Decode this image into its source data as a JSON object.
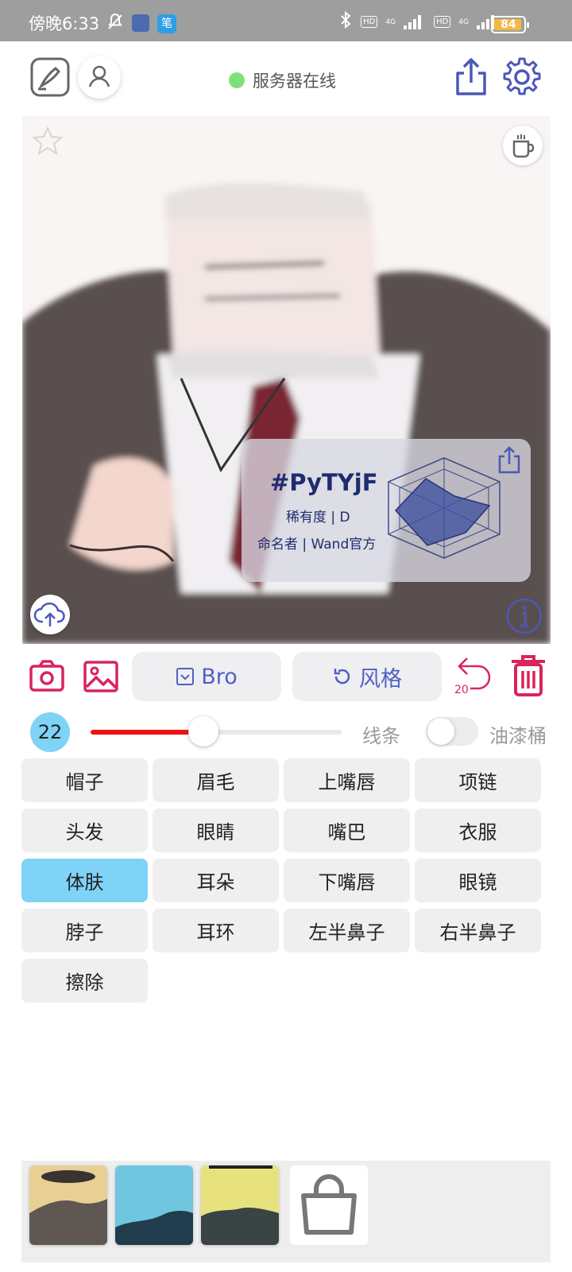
{
  "status_bar": {
    "time": "傍晚6:33",
    "net1": "HD",
    "net2": "HD",
    "gen1": "4G",
    "gen2": "4G",
    "battery": "84",
    "app2_glyph": "笔"
  },
  "header": {
    "server_status": "服务器在线",
    "status_color": "#7ee07a"
  },
  "card": {
    "code": "#PyTYjF",
    "rarity": "稀有度 | D",
    "namer": "命名者 | Wand官方"
  },
  "toolbar": {
    "bro_label": "Bro",
    "style_label": "风格",
    "undo_count": "20",
    "accent": "#d9245c",
    "pill_text": "#5160c4"
  },
  "slider": {
    "brush_size": "22",
    "value_fraction": 0.45,
    "line_label": "线条",
    "fill_label": "油漆桶",
    "fill_enabled": false
  },
  "parts": [
    {
      "label": "帽子"
    },
    {
      "label": "眉毛"
    },
    {
      "label": "上嘴唇"
    },
    {
      "label": "项链"
    },
    {
      "label": "头发"
    },
    {
      "label": "眼睛"
    },
    {
      "label": "嘴巴"
    },
    {
      "label": "衣服"
    },
    {
      "label": "体肤",
      "active": true
    },
    {
      "label": "耳朵"
    },
    {
      "label": "下嘴唇"
    },
    {
      "label": "眼镜"
    },
    {
      "label": "脖子"
    },
    {
      "label": "耳环"
    },
    {
      "label": "左半鼻子"
    },
    {
      "label": "右半鼻子"
    },
    {
      "label": "擦除"
    }
  ]
}
